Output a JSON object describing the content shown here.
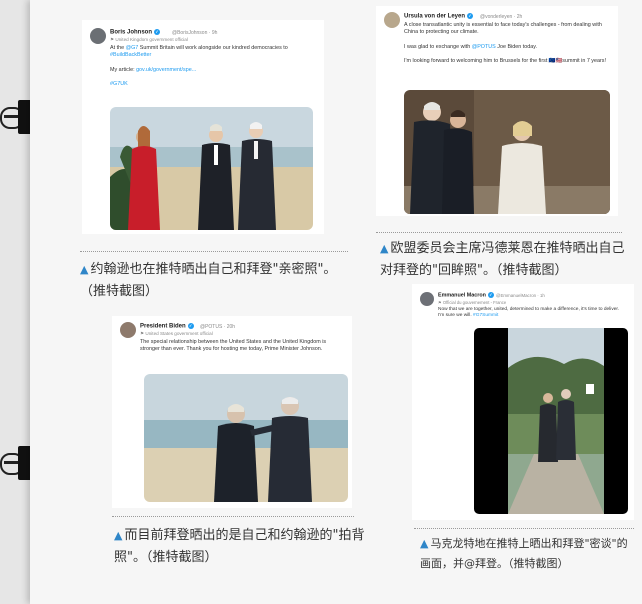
{
  "tweets": {
    "boris": {
      "name": "Boris Johnson",
      "handle": "@BorisJohnson · 9h",
      "label": "United Kingdom government official",
      "text_pre": "At the ",
      "text_link": "@G7",
      "text_post": " Summit Britain will work alongside our kindred democracies to",
      "text_hashtag": "#BuildBackBetter",
      "article_pre": "My article: ",
      "article_link": "gov.uk/government/spe...",
      "tag": "#G7UK"
    },
    "ursula": {
      "name": "Ursula von der Leyen",
      "handle": "@vonderleyen · 2h",
      "line1": "A close transatlantic unity is essential to face today's challenges - from dealing with China to protecting our climate.",
      "line2_pre": "I was glad to exchange with ",
      "line2_link": "@POTUS",
      "line2_post": " Joe Biden today.",
      "line3": "I'm looking forward to welcoming him to Brussels for the first 🇪🇺🇺🇸summit in 7 years!"
    },
    "biden": {
      "name": "President Biden",
      "handle": "@POTUS · 20h",
      "label": "United States government official",
      "text": "The special relationship between the United States and the United Kingdom is stronger than ever. Thank you for hosting me today, Prime Minister Johnson."
    },
    "macron": {
      "name": "Emmanuel Macron",
      "handle": "@EmmanuelMacron · 1h",
      "label": "Official du gouvernement - France",
      "text": "Now that we are together, united, determined to make a difference, it's time to deliver. I'm sure we will.",
      "hashtag": "#G7Summit"
    }
  },
  "captions": {
    "boris": "约翰逊也在推特晒出自己和拜登\"亲密照\"。（推特截图）",
    "ursula": "欧盟委员会主席冯德莱恩在推特晒出自己对拜登的\"回眸照\"。（推特截图）",
    "biden": "而目前拜登晒出的是自己和约翰逊的\"拍背照\"。（推特截图）",
    "macron": "马克龙特地在推特上晒出和拜登\"密谈\"的画面，并@拜登。（推特截图）"
  },
  "colors": {
    "accent": "#2f86c8",
    "verified": "#1d9bf0"
  }
}
